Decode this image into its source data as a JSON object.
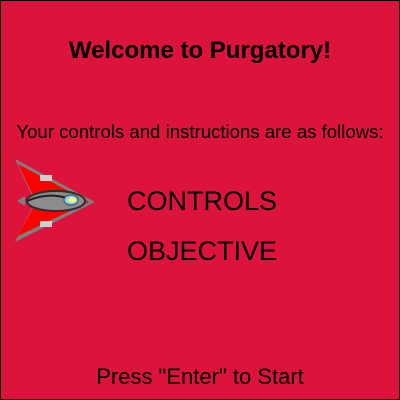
{
  "colors": {
    "background": "#DC143C",
    "border": "#000000",
    "text": "#000000"
  },
  "screen": {
    "title": "Welcome to Purgatory!",
    "subtitle": "Your controls and instructions are as follows:",
    "ship_icon": "spaceship-icon",
    "menu": {
      "controls": "CONTROLS",
      "objective": "OBJECTIVE"
    },
    "start_prompt": "Press \"Enter\" to Start"
  }
}
